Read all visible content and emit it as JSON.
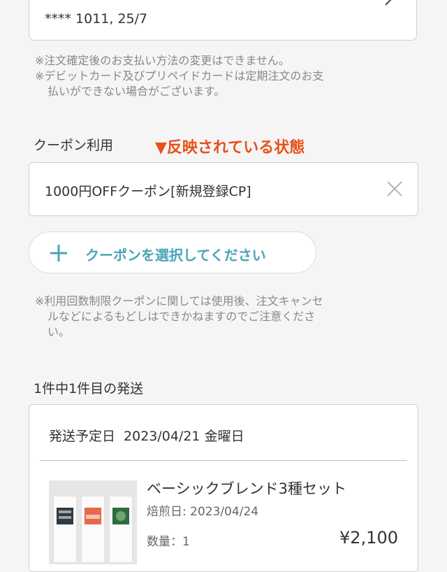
{
  "payment": {
    "card_text": "**** 1011, 25/7",
    "note_line1": "※注文確定後のお支払い方法の変更はできません。",
    "note_line2": "※デビットカード及びプリペイドカードは定期注文のお支",
    "note_line3": "払いができない場合がございます。"
  },
  "coupon": {
    "label": "クーポン利用",
    "annotation": "▼反映されている状態",
    "applied_value": "1000円OFFクーポン[新規登録CP]",
    "select_button_label": "クーポンを選択してください",
    "note_line1": "※利用回数制限クーポンに関しては使用後、注文キャンセ",
    "note_line2": "ルなどによるもどしはできかねますのでご注意くださ",
    "note_line3": "い。"
  },
  "shipment": {
    "title": "1件中1件目の発送",
    "date_label": "発送予定日",
    "date_value": "2023/04/21 金曜日",
    "product": {
      "name": "ベーシックブレンド3種セット",
      "roast_date": "焙煎日: 2023/04/24",
      "quantity": "数量：1",
      "price": "¥2,100"
    }
  },
  "colors": {
    "accent_teal": "#48a5b8",
    "annotation_orange": "#e8501a"
  }
}
